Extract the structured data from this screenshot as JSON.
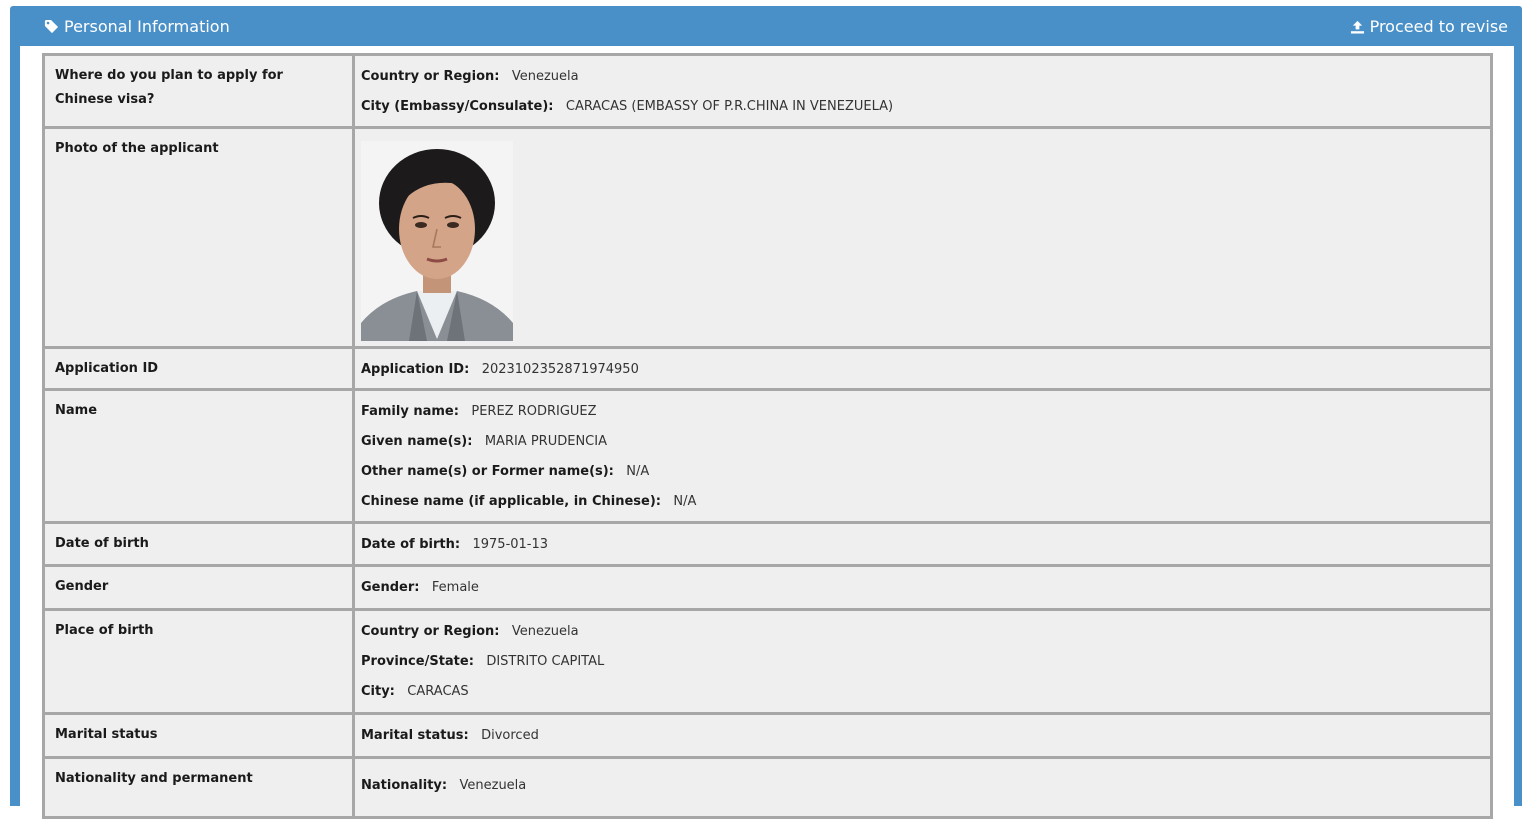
{
  "header": {
    "title": "Personal Information",
    "action": "Proceed to revise",
    "accent_color": "#4a90c8"
  },
  "rows": [
    {
      "label": "Where do you plan to apply for Chinese visa?",
      "fields": [
        {
          "key": "Country or Region:",
          "value": "Venezuela"
        },
        {
          "key": "City (Embassy/Consulate):",
          "value": "CARACAS (EMBASSY OF P.R.CHINA IN VENEZUELA)"
        }
      ]
    },
    {
      "label": "Photo of the applicant",
      "photo": "applicant-photo"
    },
    {
      "label": "Application ID",
      "fields": [
        {
          "key": "Application ID:",
          "value": "2023102352871974950"
        }
      ]
    },
    {
      "label": "Name",
      "fields": [
        {
          "key": "Family name:",
          "value": "PEREZ RODRIGUEZ"
        },
        {
          "key": "Given name(s):",
          "value": "MARIA PRUDENCIA"
        },
        {
          "key": "Other name(s) or Former name(s):",
          "value": "N/A"
        },
        {
          "key": "Chinese name (if applicable, in Chinese):",
          "value": "N/A"
        }
      ]
    },
    {
      "label": "Date of birth",
      "fields": [
        {
          "key": "Date of birth:",
          "value": "1975-01-13"
        }
      ]
    },
    {
      "label": "Gender",
      "fields": [
        {
          "key": "Gender:",
          "value": "Female"
        }
      ]
    },
    {
      "label": "Place of birth",
      "fields": [
        {
          "key": "Country or Region:",
          "value": "Venezuela"
        },
        {
          "key": "Province/State:",
          "value": "DISTRITO CAPITAL"
        },
        {
          "key": "City:",
          "value": "CARACAS"
        }
      ]
    },
    {
      "label": "Marital status",
      "fields": [
        {
          "key": "Marital status:",
          "value": "Divorced"
        }
      ]
    },
    {
      "label": "Nationality and permanent",
      "fields": [
        {
          "key": "Nationality:",
          "value": "Venezuela"
        }
      ]
    }
  ]
}
